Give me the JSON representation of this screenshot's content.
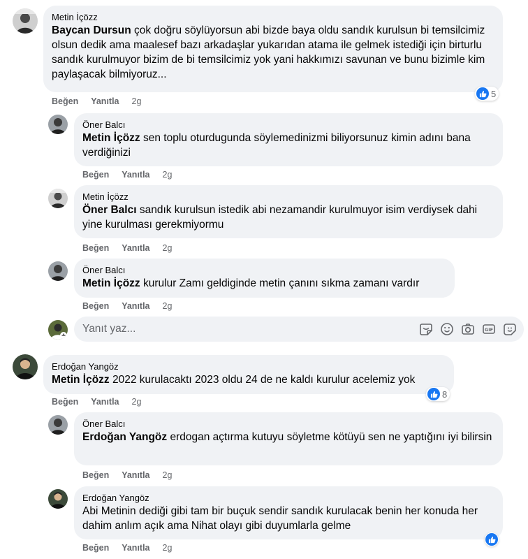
{
  "actions": {
    "like": "Beğen",
    "reply": "Yanıtla",
    "time": "2g"
  },
  "comments": [
    {
      "author": "Metin İçözz",
      "mention": "Baycan Dursun",
      "text": " çok doğru söylüyorsun abi bizde baya oldu sandık kurulsun bi temsilcimiz olsun dedik ama maalesef bazı arkadaşlar yukarıdan atama ile gelmek istediği için birturlu sandık kurulmuyor bizim de bi temsilcimiz yok yani hakkımızı savunan ve bunu bizimle kim paylaşacak bilmiyoruz...",
      "reactions": "5"
    },
    {
      "author": "Öner Balcı",
      "mention": "Metin İçözz",
      "text": " sen toplu oturdugunda söylemedinizmi biliyorsunuz kimin adını bana verdiğinizi"
    },
    {
      "author": "Metin İçözz",
      "mention": "Öner Balcı",
      "text": " sandık kurulsun istedik abi nezamandir kurulmuyor isim verdiysek dahi yine kurulması gerekmiyormu"
    },
    {
      "author": "Öner Balcı",
      "mention": "Metin İçözz",
      "text": " kurulur Zamı geldiginde metin çanını sıkma zamanı vardır"
    },
    {
      "author": "Erdoğan Yangöz",
      "mention": "Metin İçözz",
      "text": " 2022 kurulacaktı 2023 oldu 24 de ne kaldı kurulur acelemiz yok",
      "reactions": "8"
    },
    {
      "author": "Öner Balcı",
      "mention": "Erdoğan Yangöz",
      "text": " erdogan açtırma kutuyu söyletme kötüyü sen ne yaptığını iyi bilirsin"
    },
    {
      "author": "Erdoğan Yangöz",
      "mention": "",
      "text": "Abi Metinin dediği gibi tam bir buçuk sendir sandık kurulacak benin her konuda her dahim anlım açık ama Nihat olayı gibi duyumlarla gelme"
    }
  ],
  "reply_box": {
    "placeholder": "Yanıt yaz..."
  },
  "icons": {
    "like": "thumbs-up-icon",
    "sticker": "sticker-icon",
    "emoji": "emoji-icon",
    "camera": "camera-icon",
    "gif": "gif-icon",
    "avatar_sticker": "avatar-sticker-icon"
  },
  "colors": {
    "bubble": "#f0f2f5",
    "like_blue": "#1877f2",
    "secondary_text": "#65676b"
  }
}
